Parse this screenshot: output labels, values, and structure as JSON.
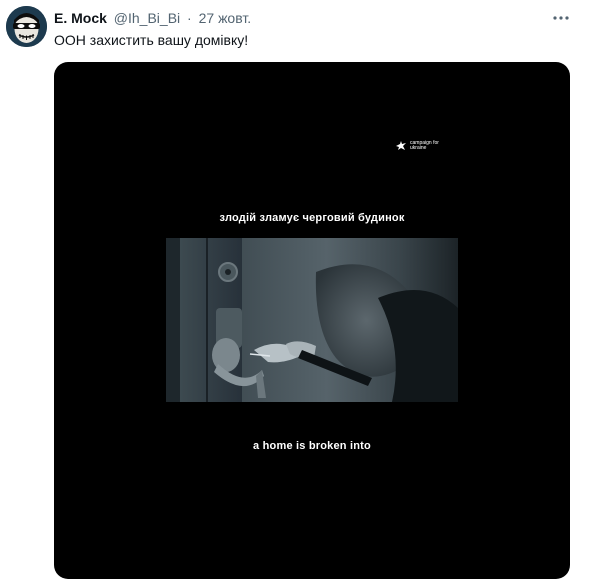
{
  "tweet": {
    "author_name": "E. Mock",
    "handle": "@Ih_Bi_Bi",
    "separator": "·",
    "date": "27 жовт.",
    "text": "ООН захистить вашу домівку!"
  },
  "media": {
    "logo_text": "campaign for ukraine",
    "caption_top": "злодій зламує черговий будинок",
    "caption_bottom": "a home is broken into"
  },
  "icons": {
    "more": "more-horizontal-icon",
    "avatar": "masked-face-avatar",
    "logo": "campaign-dove-icon"
  },
  "colors": {
    "text_primary": "#0f1419",
    "text_secondary": "#536471",
    "media_background": "#000000",
    "avatar_background": "#1d3a4e"
  }
}
